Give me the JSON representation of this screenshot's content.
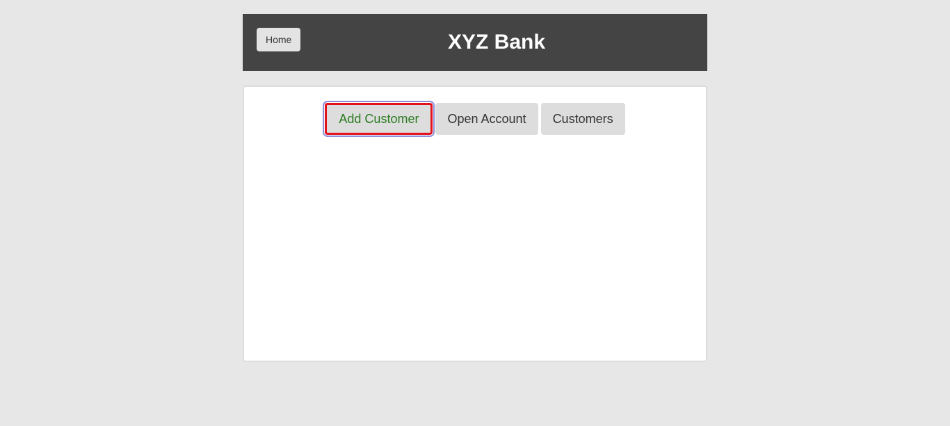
{
  "header": {
    "home_label": "Home",
    "title": "XYZ Bank"
  },
  "tabs": [
    {
      "label": "Add Customer",
      "active": true
    },
    {
      "label": "Open Account",
      "active": false
    },
    {
      "label": "Customers",
      "active": false
    }
  ],
  "colors": {
    "background": "#e7e7e7",
    "header_bg": "#444444",
    "active_text": "#2a7a1f",
    "highlight_border": "#e3111b"
  }
}
